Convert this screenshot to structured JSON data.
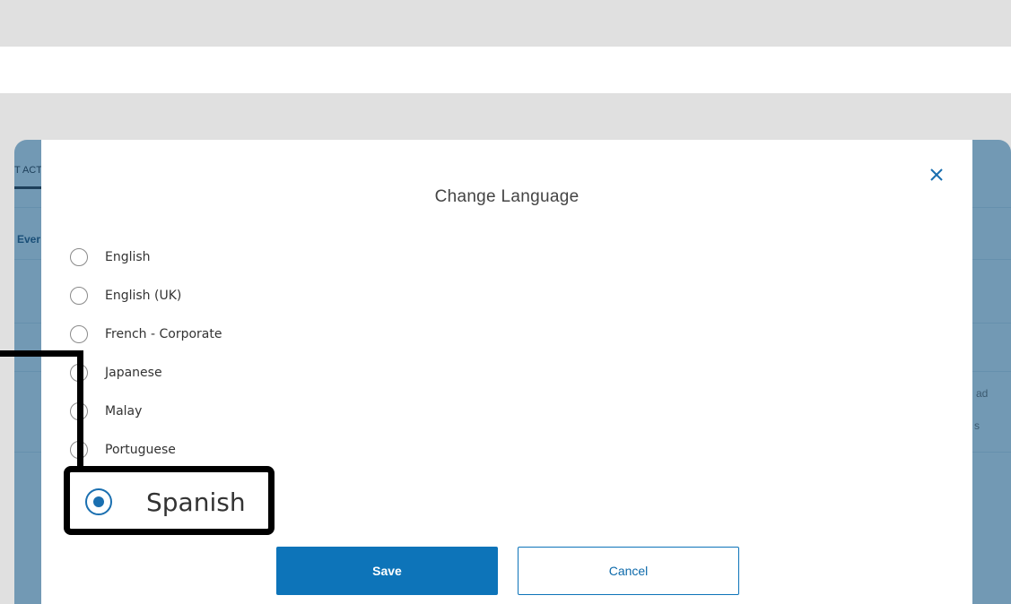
{
  "background": {
    "tab_fragment": "T ACT",
    "row_fragment": "Ever",
    "right_fragment_1": "ad",
    "right_fragment_2": "s"
  },
  "modal": {
    "title": "Change Language",
    "close_icon": "close-icon",
    "options": [
      {
        "label": "English",
        "selected": false
      },
      {
        "label": "English (UK)",
        "selected": false
      },
      {
        "label": "French - Corporate",
        "selected": false
      },
      {
        "label": "Japanese",
        "selected": false
      },
      {
        "label": "Malay",
        "selected": false
      },
      {
        "label": "Portuguese",
        "selected": false
      },
      {
        "label": "Spanish",
        "selected": true
      }
    ],
    "save_label": "Save",
    "cancel_label": "Cancel"
  },
  "colors": {
    "accent": "#0d74b9",
    "overlay": "#7299b4",
    "highlight_border": "#000000"
  }
}
